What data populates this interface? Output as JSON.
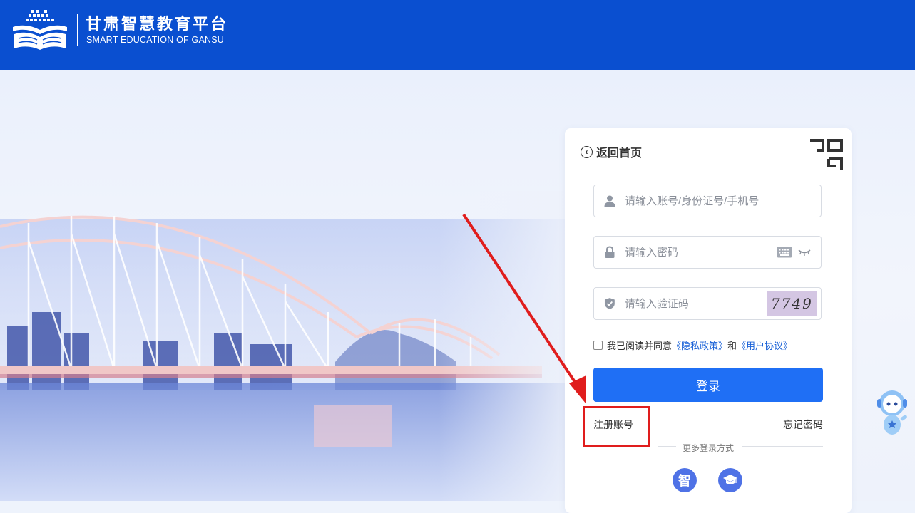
{
  "header": {
    "title": "甘肃智慧教育平台",
    "subtitle": "SMART EDUCATION OF GANSU",
    "logo_icon": "open-book-logo"
  },
  "login": {
    "back_label": "返回首页",
    "qr_icon": "qr-code-icon",
    "account_placeholder": "请输入账号/身份证号/手机号",
    "password_placeholder": "请输入密码",
    "captcha_placeholder": "请输入验证码",
    "captcha_text": "7749",
    "agree_prefix": "我已阅读并同意",
    "privacy_link": "《隐私政策》",
    "and_text": "和",
    "terms_link": "《用户协议》",
    "login_button": "登录",
    "register_link": "注册账号",
    "forgot_link": "忘记密码",
    "more_methods": "更多登录方式",
    "alt_methods": [
      {
        "icon": "zhi-icon",
        "glyph": "智"
      },
      {
        "icon": "graduation-cap-icon",
        "glyph": "🎓"
      }
    ]
  },
  "colors": {
    "header_bg": "#0a4fd0",
    "primary_button": "#1f6ff5",
    "link": "#1a62d8",
    "annotation": "#e01d1d"
  }
}
